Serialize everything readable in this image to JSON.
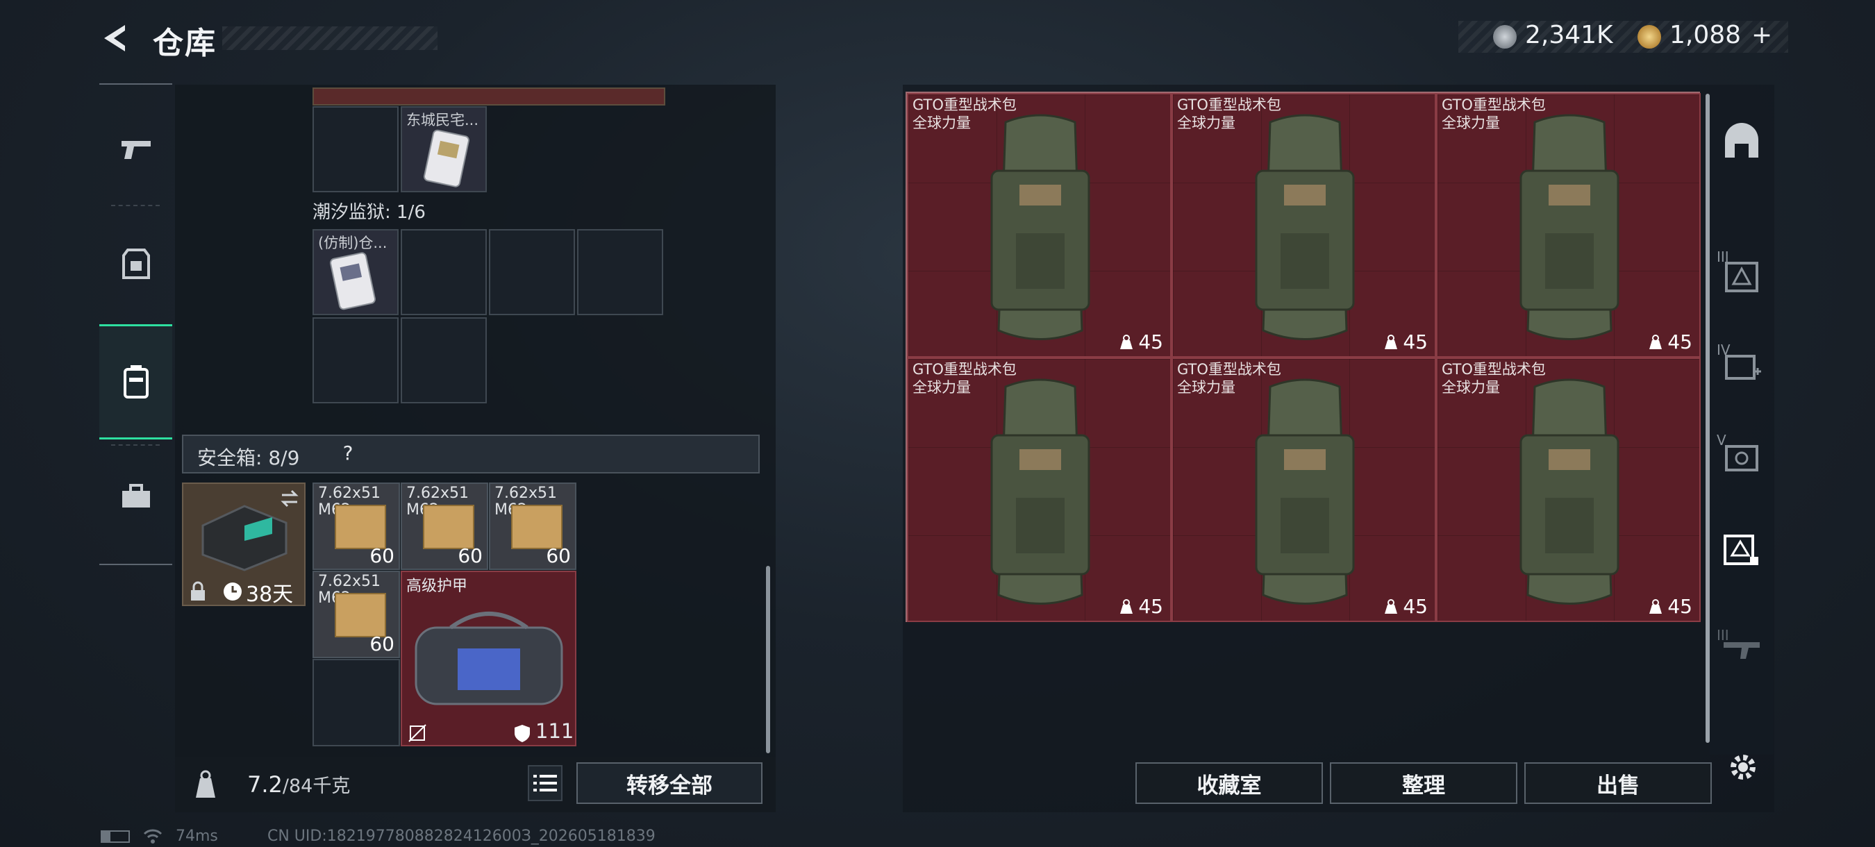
{
  "header": {
    "title": "仓库",
    "currency_1": "2,341K",
    "currency_2": "1,088",
    "currency_2_plus": "+"
  },
  "left_nav": {
    "items": [
      {
        "icon": "pistol-icon"
      },
      {
        "icon": "armor-vest-icon"
      },
      {
        "icon": "backpack-icon",
        "active": true
      },
      {
        "icon": "toolbox-icon"
      }
    ]
  },
  "storage": {
    "top_item_label": "东城民宅...",
    "section_2_label": "潮汐监狱: 1/6",
    "section_2_item_label": "(仿制)仓...",
    "safe_box_label": "安全箱: 8/9",
    "safe_box_help": "?",
    "safe_box_timer": "38天",
    "ammo_items": [
      {
        "name_line1": "7.62x51",
        "name_line2": "M62",
        "count": "60"
      },
      {
        "name_line1": "7.62x51",
        "name_line2": "M62",
        "count": "60"
      },
      {
        "name_line1": "7.62x51",
        "name_line2": "M62",
        "count": "60"
      },
      {
        "name_line1": "7.62x51",
        "name_line2": "M62",
        "count": "60"
      }
    ],
    "armor_bag": {
      "name": "高级护甲",
      "durability": "111"
    }
  },
  "bottom_bar": {
    "weight_value": "7.2",
    "weight_total": "/84千克",
    "transfer_all": "转移全部"
  },
  "backpacks": [
    {
      "name_line1": "GTO重型战术包",
      "name_line2": "全球力量",
      "weight": "45"
    },
    {
      "name_line1": "GTO重型战术包",
      "name_line2": "全球力量",
      "weight": "45"
    },
    {
      "name_line1": "GTO重型战术包",
      "name_line2": "全球力量",
      "weight": "45"
    },
    {
      "name_line1": "GTO重型战术包",
      "name_line2": "全球力量",
      "weight": "45"
    },
    {
      "name_line1": "GTO重型战术包",
      "name_line2": "全球力量",
      "weight": "45"
    },
    {
      "name_line1": "GTO重型战术包",
      "name_line2": "全球力量",
      "weight": "45"
    }
  ],
  "actions": {
    "collection": "收藏室",
    "organize": "整理",
    "sell": "出售"
  },
  "right_nav": {
    "tab_2_label": "III",
    "tab_3_label": "IV",
    "tab_4_label": "V",
    "tab_6_label": "III"
  },
  "footer": {
    "ping": "74ms",
    "uid": "CN UID:18219778088282412600З_202605181839"
  },
  "colors": {
    "accent_green": "#2ee0a0",
    "item_red": "#5a1e27",
    "panel": "#12181f"
  }
}
